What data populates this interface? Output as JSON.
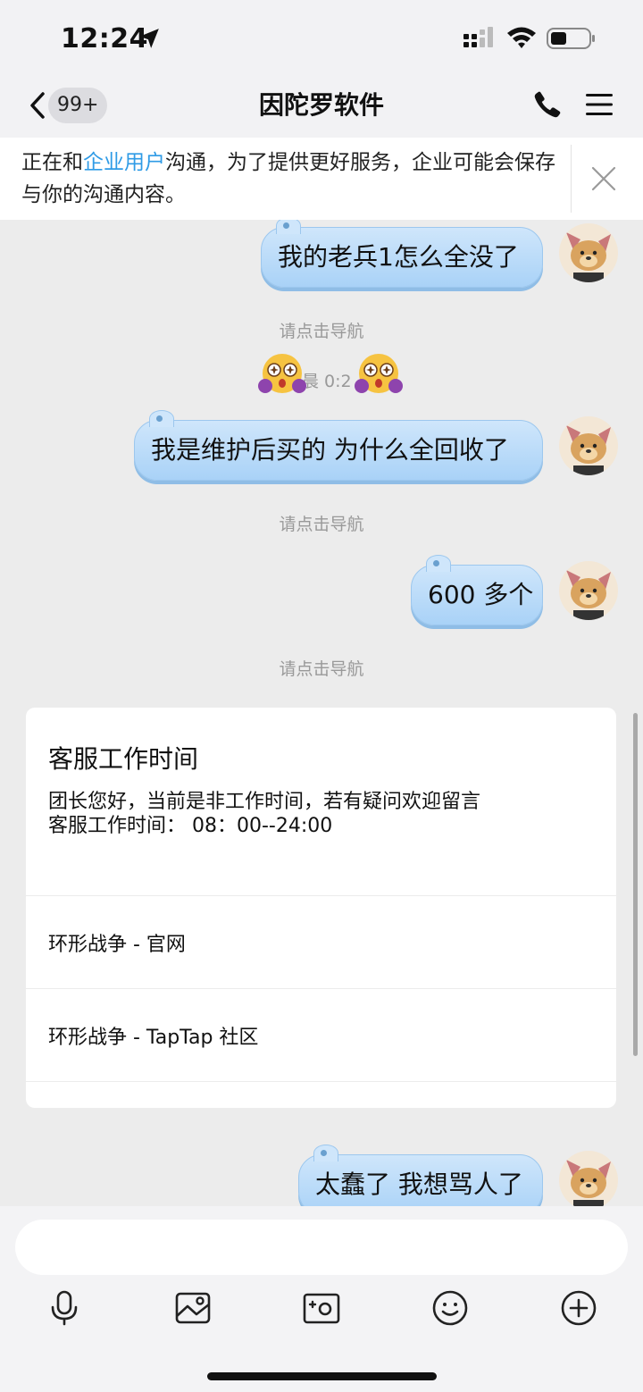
{
  "status": {
    "time": "12:24"
  },
  "header": {
    "badge": "99+",
    "title": "因陀罗软件"
  },
  "notice": {
    "prefix": "正在和",
    "highlight": "企业用户",
    "suffix": "沟通，为了提供更好服务，企业可能会保存与你的沟通内容。"
  },
  "messages": [
    {
      "text": "我的老兵1怎么全没了"
    },
    {
      "text": "我是维护后买的  为什么全回收了"
    },
    {
      "text": "600 多个"
    },
    {
      "text": "太蠢了 我想骂人了"
    }
  ],
  "system": {
    "nav_hint": "请点击导航",
    "timestamp_partial": "晨 0:2"
  },
  "card": {
    "title": "客服工作时间",
    "line1": "团长您好，当前是非工作时间，若有疑问欢迎留言",
    "line2": "客服工作时间：  08：00--24:00",
    "links": [
      "环形战争 - 官网",
      "环形战争 - TapTap 社区"
    ]
  },
  "input": {
    "placeholder": ""
  },
  "icons": [
    "location-arrow-icon",
    "signal-icon",
    "wifi-icon",
    "battery-icon",
    "back-chevron-icon",
    "phone-icon",
    "menu-icon",
    "close-icon",
    "microphone-icon",
    "image-icon",
    "camera-icon",
    "emoji-icon",
    "plus-icon"
  ]
}
